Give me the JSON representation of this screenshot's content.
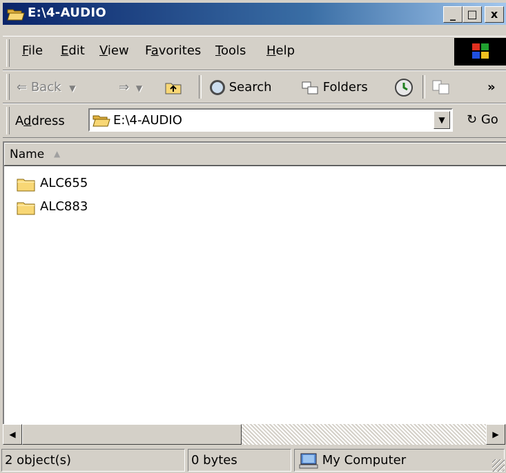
{
  "window": {
    "title": "E:\\4-AUDIO"
  },
  "title_buttons": {
    "minimize": "_",
    "maximize": "□",
    "close": "x"
  },
  "menu": {
    "items": [
      "File",
      "Edit",
      "View",
      "Favorites",
      "Tools",
      "Help"
    ]
  },
  "toolbar": {
    "back_label": "Back",
    "search_label": "Search",
    "folders_label": "Folders",
    "overflow": "»"
  },
  "address": {
    "label": "Address",
    "value": "E:\\4-AUDIO",
    "go_label": "Go"
  },
  "list": {
    "column_name": "Name",
    "sort_indicator": "▲",
    "items": [
      {
        "name": "ALC655"
      },
      {
        "name": "ALC883"
      }
    ]
  },
  "status": {
    "objects": "2 object(s)",
    "size": "0 bytes",
    "location": "My Computer"
  },
  "icons": {
    "folder": "folder-icon",
    "open_folder": "open-folder-icon",
    "computer": "my-computer-icon",
    "windows_logo": "windows-logo-icon",
    "history": "history-icon",
    "go": "go-arrow-icon"
  },
  "colors": {
    "titlebar_start": "#0a246a",
    "titlebar_end": "#a6caf0",
    "chrome": "#d4d0c8",
    "folder_yellow": "#f8d775"
  }
}
